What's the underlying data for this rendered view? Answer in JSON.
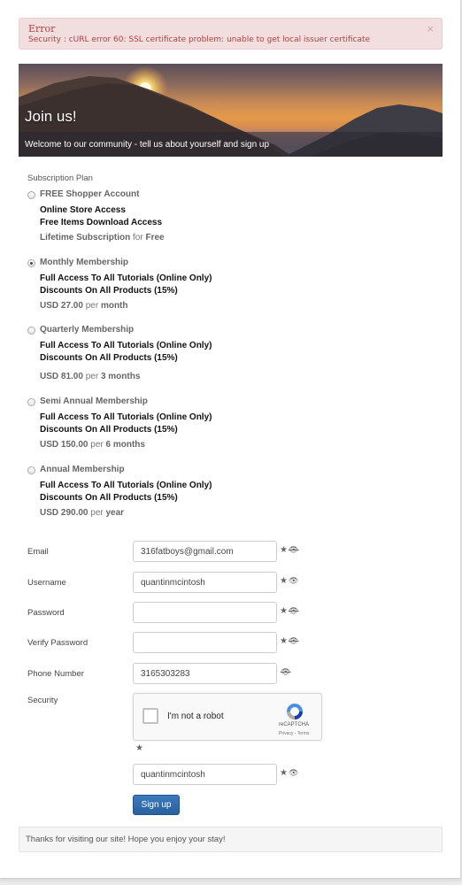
{
  "alert": {
    "title": "Error",
    "message": "Security : cURL error 60: SSL certificate problem: unable to get local issuer certificate",
    "close": "×"
  },
  "banner": {
    "title": "Join us!",
    "caption": "Welcome to our community - tell us about yourself and sign up"
  },
  "subscription": {
    "label": "Subscription Plan",
    "plans": [
      {
        "name": "FREE Shopper Account",
        "features": [
          "Online Store Access",
          "Free Items Download Access"
        ],
        "price": "Lifetime Subscription",
        "per": "for",
        "period": "Free",
        "selected": false
      },
      {
        "name": "Monthly Membership",
        "features": [
          "Full Access To All Tutorials (Online Only)",
          "Discounts On All Products (15%)"
        ],
        "price": "USD 27.00",
        "per": "per",
        "period": "month",
        "selected": true
      },
      {
        "name": "Quarterly Membership",
        "features": [
          "Full Access To All Tutorials (Online Only)",
          "Discounts On All Products (15%)"
        ],
        "price": "USD 81.00",
        "per": "per",
        "period": "3 months",
        "selected": false
      },
      {
        "name": "Semi Annual Membership",
        "features": [
          "Full Access To All Tutorials (Online Only)",
          "Discounts On All Products (15%)"
        ],
        "price": "USD 150.00",
        "per": "per",
        "period": "6 months",
        "selected": false
      },
      {
        "name": "Annual Membership",
        "features": [
          "Full Access To All Tutorials (Online Only)",
          "Discounts On All Products (15%)"
        ],
        "price": "USD 290.00",
        "per": "per",
        "period": "year",
        "selected": false
      }
    ]
  },
  "form": {
    "email": {
      "label": "Email",
      "value": "316fatboys@gmail.com"
    },
    "username": {
      "label": "Username",
      "value": "quantinmcintosh"
    },
    "password": {
      "label": "Password",
      "value": ""
    },
    "verify_password": {
      "label": "Verify Password",
      "value": ""
    },
    "phone": {
      "label": "Phone Number",
      "value": "3165303283"
    },
    "security": {
      "label": "Security",
      "value": "quantinmcintosh"
    },
    "captcha": {
      "text": "I'm not a robot",
      "brand": "reCAPTCHA",
      "terms": "Privacy - Terms"
    },
    "icons": {
      "star": "★",
      "eye": "👁"
    },
    "signup_label": "Sign up"
  },
  "footer": {
    "text": "Thanks for visiting our site! Hope you enjoy your stay!"
  }
}
